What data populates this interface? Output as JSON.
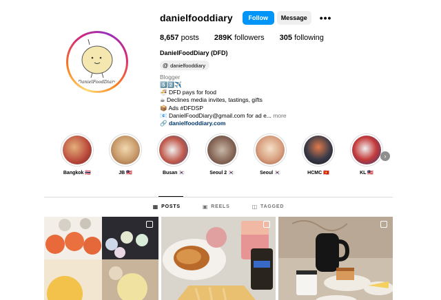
{
  "profile": {
    "username": "danielfooddiary",
    "full_name": "DanielFoodDiary (DFD)",
    "threads_handle": "danielfooddiary",
    "avatar_text": "DanielFoodDiary"
  },
  "actions": {
    "follow_label": "Follow",
    "message_label": "Message",
    "more_label": "•••"
  },
  "stats": {
    "posts_value": "8,657",
    "posts_label": "posts",
    "followers_value": "289K",
    "followers_label": "followers",
    "following_value": "305",
    "following_label": "following"
  },
  "bio": {
    "category": "Blogger",
    "line1": "5️⃣2️⃣✈️",
    "line2": "🍜 DFD pays for food",
    "line3": "☕ Declines media invites, tastings, gifts",
    "line4": "📦 Ads #DFDSP",
    "line5": "📧 DanielFoodDiary@gmail.com for ad e...",
    "more": "more",
    "link": "danielfooddiary.com"
  },
  "highlights": [
    {
      "label": "Bangkok 🇹🇭",
      "color": "#b8463a"
    },
    {
      "label": "JB 🇲🇾",
      "color": "#c89a6a"
    },
    {
      "label": "Busan 🇰🇷",
      "color": "#c0584a"
    },
    {
      "label": "Seoul 2 🇰🇷",
      "color": "#8a6a5a"
    },
    {
      "label": "Seoul 🇰🇷",
      "color": "#d8a080"
    },
    {
      "label": "HCMC 🇻🇳",
      "color": "#3a3a48"
    },
    {
      "label": "KL 🇲🇾",
      "color": "#c43a3a"
    }
  ],
  "tabs": [
    {
      "label": "POSTS",
      "icon": "grid-icon"
    },
    {
      "label": "REELS",
      "icon": "reels-icon"
    },
    {
      "label": "TAGGED",
      "icon": "tagged-icon"
    }
  ],
  "colors": {
    "accent": "#0095f6",
    "link": "#00376b",
    "muted": "#737373"
  }
}
